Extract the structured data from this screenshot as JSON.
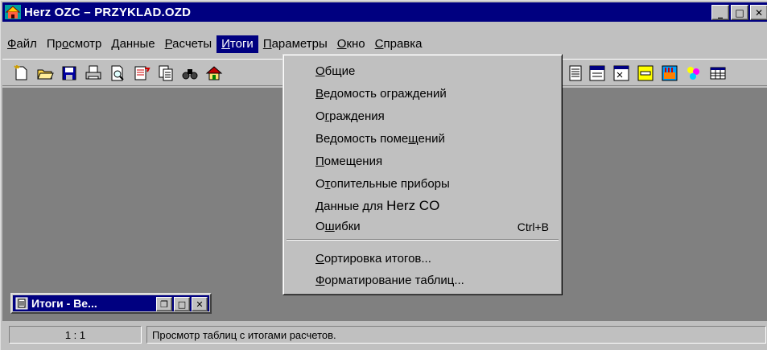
{
  "window": {
    "title": "Herz OZC – PRZYKLAD.OZD",
    "minimize_glyph": "_",
    "maximize_glyph": "□",
    "close_glyph": "✕"
  },
  "menubar": {
    "items": [
      {
        "pre": "",
        "acc": "Ф",
        "post": "айл"
      },
      {
        "pre": "Пр",
        "acc": "о",
        "post": "смотр"
      },
      {
        "pre": "",
        "acc": "Д",
        "post": "анные"
      },
      {
        "pre": "",
        "acc": "Р",
        "post": "асчеты"
      },
      {
        "pre": "",
        "acc": "И",
        "post": "тоги"
      },
      {
        "pre": "",
        "acc": "П",
        "post": "араметры"
      },
      {
        "pre": "",
        "acc": "О",
        "post": "кно"
      },
      {
        "pre": "",
        "acc": "С",
        "post": "правка"
      }
    ]
  },
  "dropdown": {
    "items": [
      {
        "pre": "",
        "acc": "О",
        "post": "бщие"
      },
      {
        "pre": "",
        "acc": "В",
        "post": "едомость ограждений"
      },
      {
        "pre": "О",
        "acc": "г",
        "post": "раждения"
      },
      {
        "pre": "Ведомость поме",
        "acc": "щ",
        "post": "ений"
      },
      {
        "pre": "",
        "acc": "П",
        "post": "омещения"
      },
      {
        "pre": "О",
        "acc": "т",
        "post": "опительные приборы"
      },
      {
        "pre": "",
        "acc": "Д",
        "post": "анные для ",
        "big": "Herz CO"
      },
      {
        "pre": "О",
        "acc": "ш",
        "post": "ибки",
        "shortcut": "Ctrl+B"
      },
      {
        "pre": "",
        "acc": "С",
        "post": "ортировка итогов..."
      },
      {
        "pre": "",
        "acc": "Ф",
        "post": "орматирование таблиц..."
      }
    ]
  },
  "mdi_window": {
    "title": "Итоги - Ве...",
    "restore_glyph": "❐",
    "maximize_glyph": "□",
    "close_glyph": "✕"
  },
  "statusbar": {
    "position": "1 : 1",
    "message": "Просмотр таблиц с итогами расчетов."
  },
  "toolbar": {
    "icons": [
      "new-icon",
      "open-icon",
      "save-icon",
      "print-icon",
      "print-preview-icon",
      "import-icon",
      "copy-icon",
      "find-icon",
      "house-icon",
      "table-icon",
      "form-icon",
      "doc-icon",
      "window-icon",
      "radiator-icon",
      "scene-icon",
      "color-icon",
      "grid-icon"
    ]
  },
  "colors": {
    "titlebar": "#000080",
    "face": "#c0c0c0",
    "client": "#808080"
  }
}
